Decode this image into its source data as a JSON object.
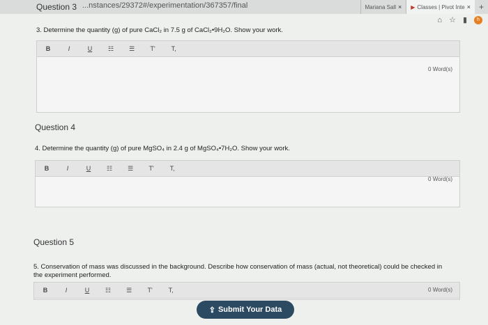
{
  "browser": {
    "url": "...nstances/29372#/experimentation/367357/final",
    "tabs": [
      {
        "label": "Mariana Sall",
        "close": "×"
      },
      {
        "label": "Classes | Pivot Inte",
        "close": "×"
      }
    ],
    "new_tab": "+",
    "avatar_letter": "h"
  },
  "toolbar_labels": {
    "bold": "B",
    "italic": "I",
    "underline": "U",
    "ol": "☷",
    "ul": "☰",
    "sup": "T'",
    "sub": "T,"
  },
  "questions": [
    {
      "heading": "Question 3",
      "text": "3. Determine the quantity (g) of pure CaCl₂ in 7.5 g of CaCl₂•9H₂O. Show your work.",
      "word_count": "0 Word(s)"
    },
    {
      "heading": "Question 4",
      "text": "4. Determine the quantity (g) of pure MgSO₄ in 2.4 g of MgSO₄•7H₂O. Show your work.",
      "word_count": "0 Word(s)"
    },
    {
      "heading": "Question 5",
      "text": "5. Conservation of mass was discussed in the background. Describe how conservation of mass (actual, not theoretical) could be checked in the experiment performed.",
      "word_count": "0 Word(s)"
    }
  ],
  "submit": {
    "label": "Submit Your Data",
    "icon": "upload-icon"
  },
  "colors": {
    "submit_bg": "#2d4a63",
    "avatar": "#e67e22"
  }
}
